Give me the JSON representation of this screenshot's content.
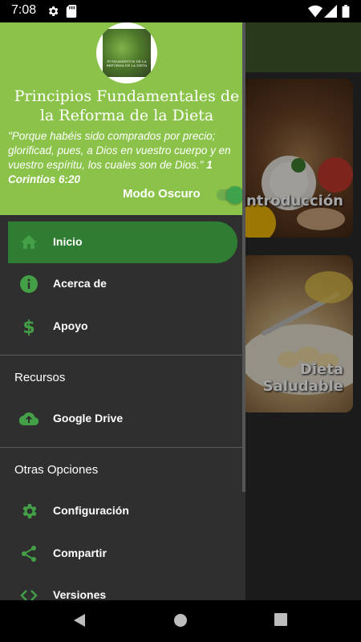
{
  "status_bar": {
    "time": "7:08"
  },
  "drawer": {
    "logo_text": "FUNDAMENTOS DE LA REFORMA DE LA DIETA",
    "title": "Principios Fundamentales de la Reforma de la Dieta",
    "verse_text": "\"Porque habéis sido comprados por precio; glorificad, pues, a Dios en vuestro cuerpo y en vuestro espíritu, los cuales son de Dios.\"",
    "verse_ref": "1 Corintios 6:20",
    "dark_mode_label": "Modo Oscuro",
    "dark_mode_on": true,
    "items": [
      {
        "label": "Inicio",
        "icon": "home-icon",
        "active": true
      },
      {
        "label": "Acerca de",
        "icon": "info-icon"
      },
      {
        "label": "Apoyo",
        "icon": "dollar-icon"
      }
    ],
    "resources_title": "Recursos",
    "resources": [
      {
        "label": "Google Drive",
        "icon": "cloud-upload-icon"
      }
    ],
    "other_title": "Otras Opciones",
    "other": [
      {
        "label": "Configuración",
        "icon": "gear-icon"
      },
      {
        "label": "Compartir",
        "icon": "share-icon"
      },
      {
        "label": "Versiones",
        "icon": "code-icon"
      }
    ]
  },
  "cards": [
    {
      "title": "Introducción"
    },
    {
      "title": "Dieta Saludable"
    }
  ],
  "colors": {
    "header_green": "#8bc34a",
    "active_item": "#2e7d32",
    "icon_green": "#43a047",
    "drawer_bg": "#2f2f2f"
  }
}
